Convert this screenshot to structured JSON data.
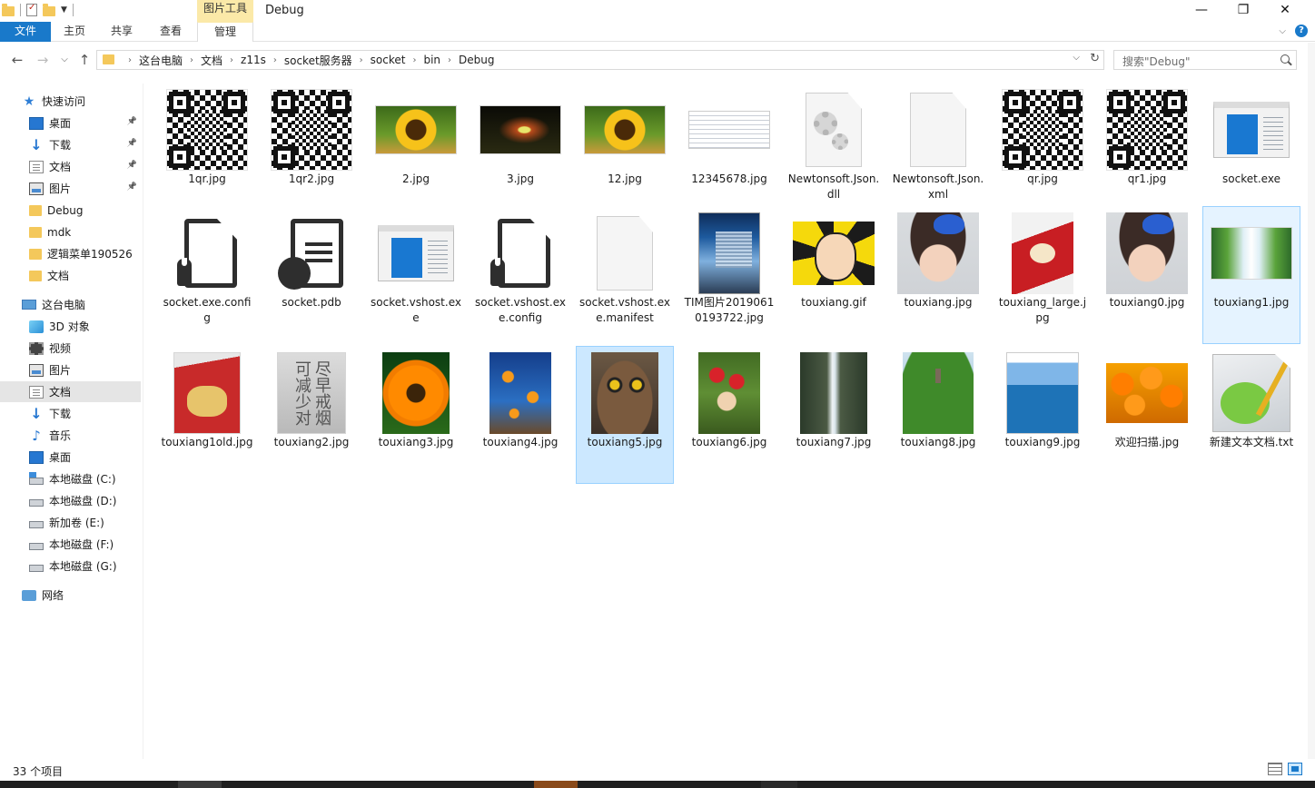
{
  "titlebar": {
    "context_group": "图片工具",
    "title": "Debug",
    "minimize": "—",
    "maximize": "❐",
    "close": "✕"
  },
  "ribbon": {
    "tabs": [
      "文件",
      "主页",
      "共享",
      "查看",
      "管理"
    ],
    "expand": "⌵",
    "help": "?"
  },
  "nav": {
    "back": "←",
    "forward": "→",
    "recent": "⌵",
    "up": "↑",
    "breadcrumb": [
      "这台电脑",
      "文档",
      "z11s",
      "socket服务器",
      "socket",
      "bin",
      "Debug"
    ],
    "crumb_sep": "›",
    "dropdown": "⌵",
    "refresh": "↻",
    "search_placeholder": "搜索\"Debug\""
  },
  "sidebar": {
    "quick_access": "快速访问",
    "quick_items": [
      {
        "label": "桌面",
        "icon": "desktop-icon",
        "pinned": true
      },
      {
        "label": "下载",
        "icon": "download-icon",
        "pinned": true
      },
      {
        "label": "文档",
        "icon": "document-icon",
        "pinned": true
      },
      {
        "label": "图片",
        "icon": "pictures-icon",
        "pinned": true
      },
      {
        "label": "Debug",
        "icon": "folder-icon",
        "pinned": false
      },
      {
        "label": "mdk",
        "icon": "folder-icon",
        "pinned": false
      },
      {
        "label": "逻辑菜单190526",
        "icon": "folder-icon",
        "pinned": false
      },
      {
        "label": "文档",
        "icon": "folder-icon",
        "pinned": false
      }
    ],
    "this_pc": "这台电脑",
    "pc_items": [
      {
        "label": "3D 对象",
        "icon": "3d-objects-icon"
      },
      {
        "label": "视频",
        "icon": "video-icon"
      },
      {
        "label": "图片",
        "icon": "pictures-icon"
      },
      {
        "label": "文档",
        "icon": "document-icon",
        "selected": true
      },
      {
        "label": "下载",
        "icon": "download-icon"
      },
      {
        "label": "音乐",
        "icon": "music-icon"
      },
      {
        "label": "桌面",
        "icon": "desktop-icon"
      },
      {
        "label": "本地磁盘 (C:)",
        "icon": "system-drive-icon"
      },
      {
        "label": "本地磁盘 (D:)",
        "icon": "drive-icon"
      },
      {
        "label": "新加卷 (E:)",
        "icon": "drive-icon"
      },
      {
        "label": "本地磁盘 (F:)",
        "icon": "drive-icon"
      },
      {
        "label": "本地磁盘 (G:)",
        "icon": "drive-icon"
      }
    ],
    "network": "网络"
  },
  "files": [
    {
      "name": "1qr.jpg",
      "thumb": "qr"
    },
    {
      "name": "1qr2.jpg",
      "thumb": "qr"
    },
    {
      "name": "2.jpg",
      "thumb": "sunflower"
    },
    {
      "name": "3.jpg",
      "thumb": "fireworks"
    },
    {
      "name": "12.jpg",
      "thumb": "sunflower"
    },
    {
      "name": "12345678.jpg",
      "thumb": "listshot"
    },
    {
      "name": "Newtonsoft.Json.dll",
      "thumb": "dll"
    },
    {
      "name": "Newtonsoft.Json.xml",
      "thumb": "blank"
    },
    {
      "name": "qr.jpg",
      "thumb": "qr"
    },
    {
      "name": "qr1.jpg",
      "thumb": "qr"
    },
    {
      "name": "socket.exe",
      "thumb": "exe"
    },
    {
      "name": "socket.exe.config",
      "thumb": "config"
    },
    {
      "name": "socket.pdb",
      "thumb": "pdb"
    },
    {
      "name": "socket.vshost.exe",
      "thumb": "exe"
    },
    {
      "name": "socket.vshost.exe.config",
      "thumb": "config"
    },
    {
      "name": "socket.vshost.exe.manifest",
      "thumb": "blank"
    },
    {
      "name": "TIM图片20190610193722.jpg",
      "thumb": "tim"
    },
    {
      "name": "touxiang.gif",
      "thumb": "gif"
    },
    {
      "name": "touxiang.jpg",
      "thumb": "girl"
    },
    {
      "name": "touxiang_large.jpg",
      "thumb": "pack-red"
    },
    {
      "name": "touxiang0.jpg",
      "thumb": "girl"
    },
    {
      "name": "touxiang1.jpg",
      "thumb": "waterfall",
      "state": "hover"
    },
    {
      "name": "touxiang1old.jpg",
      "thumb": "pack-red2"
    },
    {
      "name": "touxiang2.jpg",
      "thumb": "gray-pack",
      "overlay_text": "尽早戒烟可减少对"
    },
    {
      "name": "touxiang3.jpg",
      "thumb": "orange-flower"
    },
    {
      "name": "touxiang4.jpg",
      "thumb": "fish"
    },
    {
      "name": "touxiang5.jpg",
      "thumb": "owl",
      "state": "selected"
    },
    {
      "name": "touxiang6.jpg",
      "thumb": "gnomes"
    },
    {
      "name": "touxiang7.jpg",
      "thumb": "cliff"
    },
    {
      "name": "touxiang8.jpg",
      "thumb": "hill"
    },
    {
      "name": "touxiang9.jpg",
      "thumb": "beach"
    },
    {
      "name": "欢迎扫描.jpg",
      "thumb": "marigold"
    },
    {
      "name": "新建文本文档.txt",
      "thumb": "notepadpp"
    }
  ],
  "status": {
    "count": "33 个项目"
  },
  "colors": {
    "accent": "#1979ca",
    "selection": "#cce8ff",
    "context_tab": "#fbe9a8"
  }
}
